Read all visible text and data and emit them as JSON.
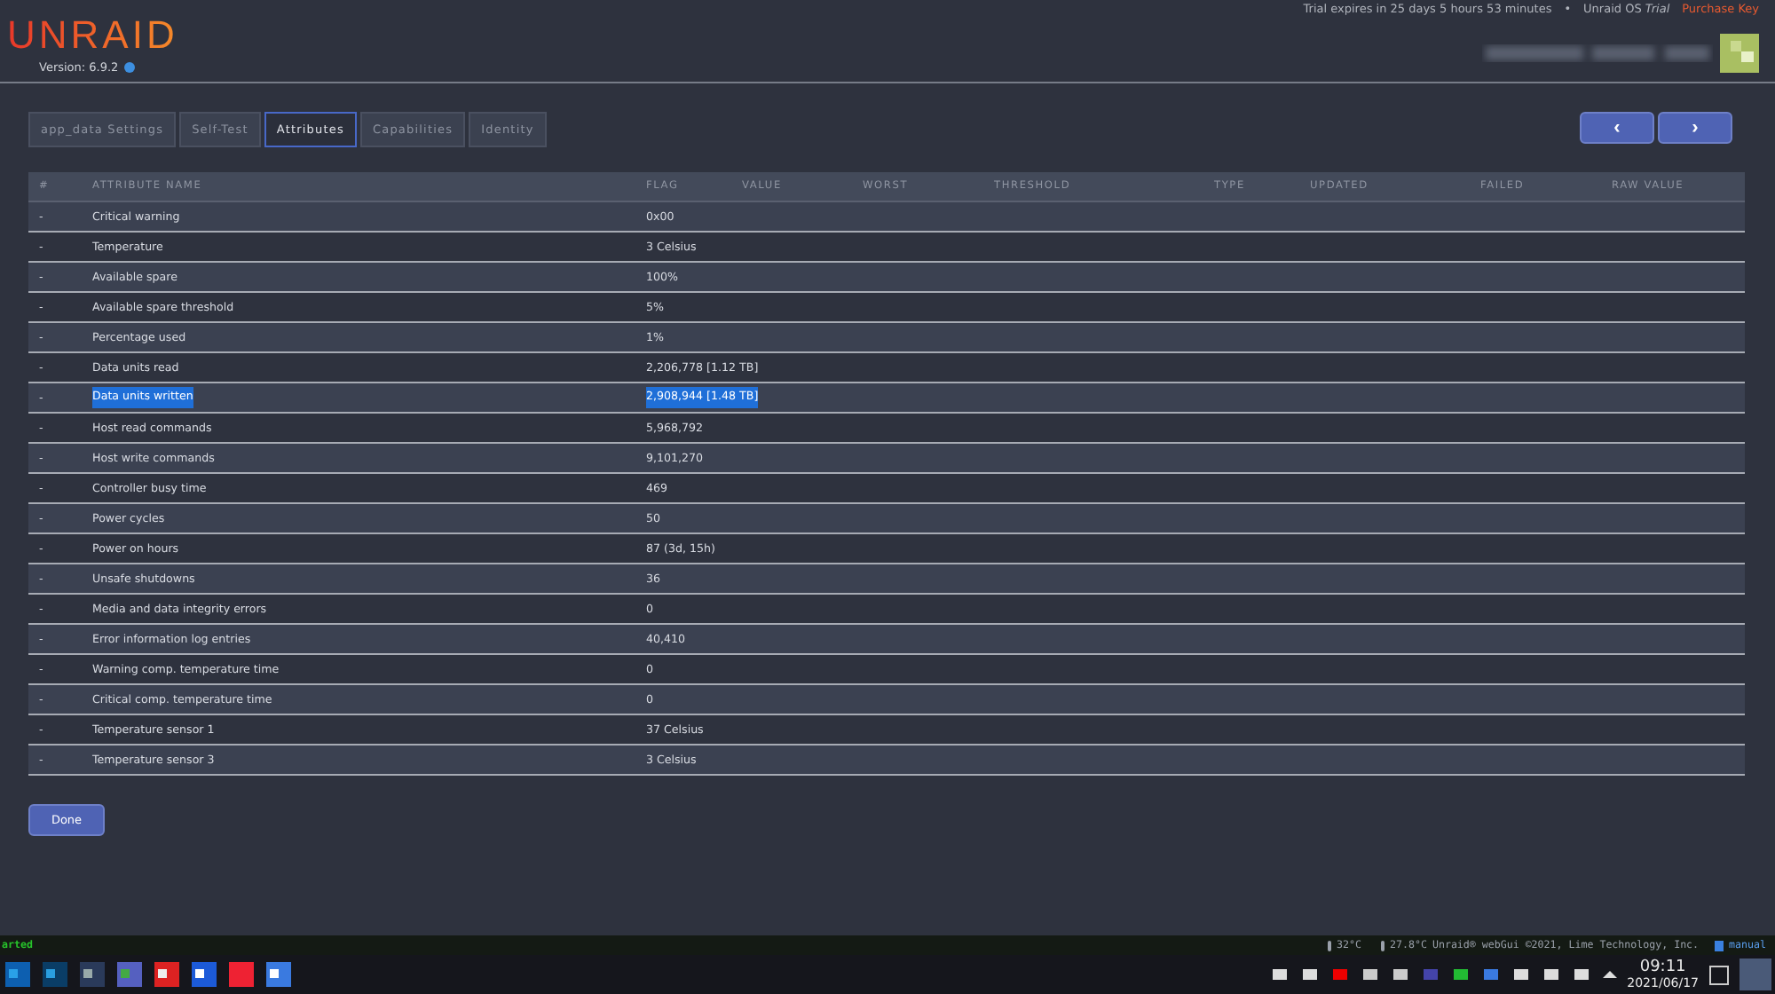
{
  "header": {
    "logo": "UNRAID",
    "version": "Version: 6.9.2",
    "trial": "Trial expires in 25 days 5 hours 53 minutes",
    "separator": "•",
    "os_label": "Unraid OS",
    "os_edition": "Trial",
    "purchase": "Purchase Key"
  },
  "tabs": [
    {
      "label": "app_data Settings",
      "selected": false
    },
    {
      "label": "Self-Test",
      "selected": false
    },
    {
      "label": "Attributes",
      "selected": true
    },
    {
      "label": "Capabilities",
      "selected": false
    },
    {
      "label": "Identity",
      "selected": false
    }
  ],
  "nav_buttons": [
    "‹",
    "›"
  ],
  "table": {
    "columns": [
      "#",
      "ATTRIBUTE NAME",
      "FLAG",
      "VALUE",
      "WORST",
      "THRESHOLD",
      "TYPE",
      "UPDATED",
      "FAILED",
      "RAW VALUE"
    ],
    "rows": [
      {
        "num": "-",
        "name": "Critical warning",
        "flag": "0x00",
        "highlighted": false
      },
      {
        "num": "-",
        "name": "Temperature",
        "flag": "3 Celsius",
        "highlighted": false
      },
      {
        "num": "-",
        "name": "Available spare",
        "flag": "100%",
        "highlighted": false
      },
      {
        "num": "-",
        "name": "Available spare threshold",
        "flag": "5%",
        "highlighted": false
      },
      {
        "num": "-",
        "name": "Percentage used",
        "flag": "1%",
        "highlighted": false
      },
      {
        "num": "-",
        "name": "Data units read",
        "flag": "2,206,778 [1.12 TB]",
        "highlighted": false
      },
      {
        "num": "-",
        "name": "Data units written",
        "flag": "2,908,944 [1.48 TB]",
        "highlighted": true
      },
      {
        "num": "-",
        "name": "Host read commands",
        "flag": "5,968,792",
        "highlighted": false
      },
      {
        "num": "-",
        "name": "Host write commands",
        "flag": "9,101,270",
        "highlighted": false
      },
      {
        "num": "-",
        "name": "Controller busy time",
        "flag": "469",
        "highlighted": false
      },
      {
        "num": "-",
        "name": "Power cycles",
        "flag": "50",
        "highlighted": false
      },
      {
        "num": "-",
        "name": "Power on hours",
        "flag": "87 (3d, 15h)",
        "highlighted": false
      },
      {
        "num": "-",
        "name": "Unsafe shutdowns",
        "flag": "36",
        "highlighted": false
      },
      {
        "num": "-",
        "name": "Media and data integrity errors",
        "flag": "0",
        "highlighted": false
      },
      {
        "num": "-",
        "name": "Error information log entries",
        "flag": "40,410",
        "highlighted": false
      },
      {
        "num": "-",
        "name": "Warning comp. temperature time",
        "flag": "0",
        "highlighted": false
      },
      {
        "num": "-",
        "name": "Critical comp. temperature time",
        "flag": "0",
        "highlighted": false
      },
      {
        "num": "-",
        "name": "Temperature sensor 1",
        "flag": "37 Celsius",
        "highlighted": false
      },
      {
        "num": "-",
        "name": "Temperature sensor 3",
        "flag": "3 Celsius",
        "highlighted": false
      }
    ]
  },
  "done_button": "Done",
  "status_bar": {
    "status": "arted",
    "temp_1": "32°C",
    "temp_2": "27.8°C",
    "copyright": "Unraid® webGui ©2021, Lime Technology, Inc.",
    "manual": "manual"
  },
  "taskbar": {
    "time": "09:11",
    "date": "2021/06/17"
  }
}
